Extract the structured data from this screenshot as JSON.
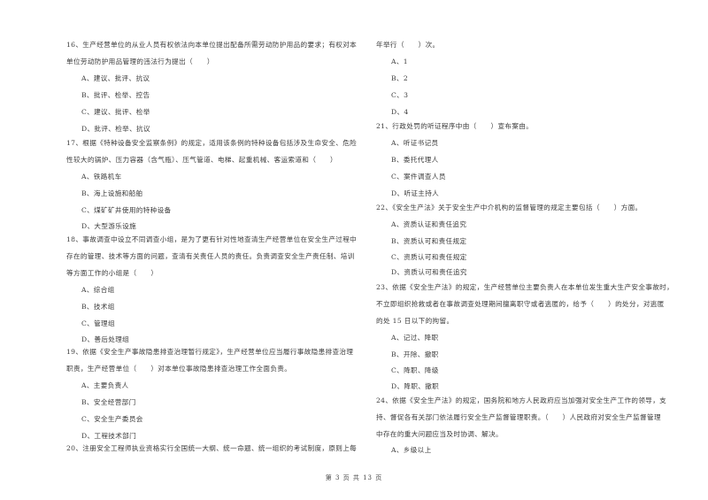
{
  "page": {
    "footer": "第 3 页 共 13 页"
  },
  "left_column": {
    "q16": {
      "lines": [
        "16、生产经营单位的从业人员有权依法向本单位提出配备所需劳动防护用品的要求；有权对本",
        "单位劳动防护用品管理的违法行为提出（　　）"
      ],
      "options": [
        "A、建议、批评、抗议",
        "B、批评、检举、控告",
        "C、建议、批评、检举",
        "D、批评、检举、抗议"
      ]
    },
    "q17": {
      "lines": [
        "17、根据《特种设备安全监察条例》的规定，适用该条例的特种设备包括涉及生命安全、危险",
        "性较大的锅炉、压力容器（含气瓶）、压气管道、电梯、起重机械、客运索道和（　　）"
      ],
      "options": [
        "A、铁路机车",
        "B、海上设施和船舶",
        "C、煤矿矿井使用的特种设备",
        "D、大型游乐设施"
      ]
    },
    "q18": {
      "lines": [
        "18、事故调查中设立不同调查小组，是为了更有针对性地查清生产经营单位在安全生产过程中",
        "存在的管理、技术等方面的问题，查清有关责任人员的责任。负责调查安全生产责任制、培训",
        "等方面工作的小组是（　　）"
      ],
      "options": [
        "A、综合组",
        "B、技术组",
        "C、管理组",
        "D、善后处理组"
      ]
    },
    "q19": {
      "lines": [
        "19、依据《安全生产事故隐患排查治理暂行规定》，生产经营单位应当履行事故隐患排查治理",
        "职责，生产经营单位（　　）对本单位事故隐患排查治理工作全面负责。"
      ],
      "options": [
        "A、主要负责人",
        "B、安全经营部门",
        "C、安全生产委员会",
        "D、工程技术部门"
      ]
    },
    "q20": {
      "lines": [
        "20、注册安全工程师执业资格实行全国统一大纲、统一命题、统一组织的考试制度，原则上每"
      ]
    }
  },
  "right_column": {
    "q20_cont": {
      "lines": [
        "年举行（　　）次。"
      ],
      "options": [
        "A、1",
        "B、2",
        "C、3",
        "D、4"
      ]
    },
    "q21": {
      "lines": [
        "21、行政处罚的听证程序中由（　　）宣布案由。"
      ],
      "options": [
        "A、听证书记员",
        "B、委托代理人",
        "C、案件调查人员",
        "D、听证主持人"
      ]
    },
    "q22": {
      "lines": [
        "22、《安全生产法》关于安全生产中介机构的监督管理的规定主要包括（　　）方面。"
      ],
      "options": [
        "A、资质认证和责任追究",
        "B、资质认可和责任规定",
        "C、资质认可和责任规定",
        "D、资质认可和责任追究"
      ]
    },
    "q23": {
      "lines": [
        "23、依据《安全生产法》的规定，生产经营单位主要负责人在本单位发生重大生产安全事故时，",
        "不立即组织抢救或者在事故调查处理期间擅离职守或者逃匿的，给予（　　）的处分，对逃匿",
        "的处 15 日以下的拘留。"
      ],
      "options": [
        "A、记过、降职",
        "B、开除、撤职",
        "C、降职、降级",
        "D、降职、撤职"
      ]
    },
    "q24": {
      "lines": [
        "24、依据《安全生产法》的规定，国务院和地方人民政府应当加强对安全生产工作的领导，支",
        "持、督促各有关部门依法履行安全生产监督管理职责。（　　）人民政府对安全生产监督管理",
        "中存在的重大问题应当及时协调、解决。"
      ],
      "options": [
        "A、乡级以上"
      ]
    }
  }
}
